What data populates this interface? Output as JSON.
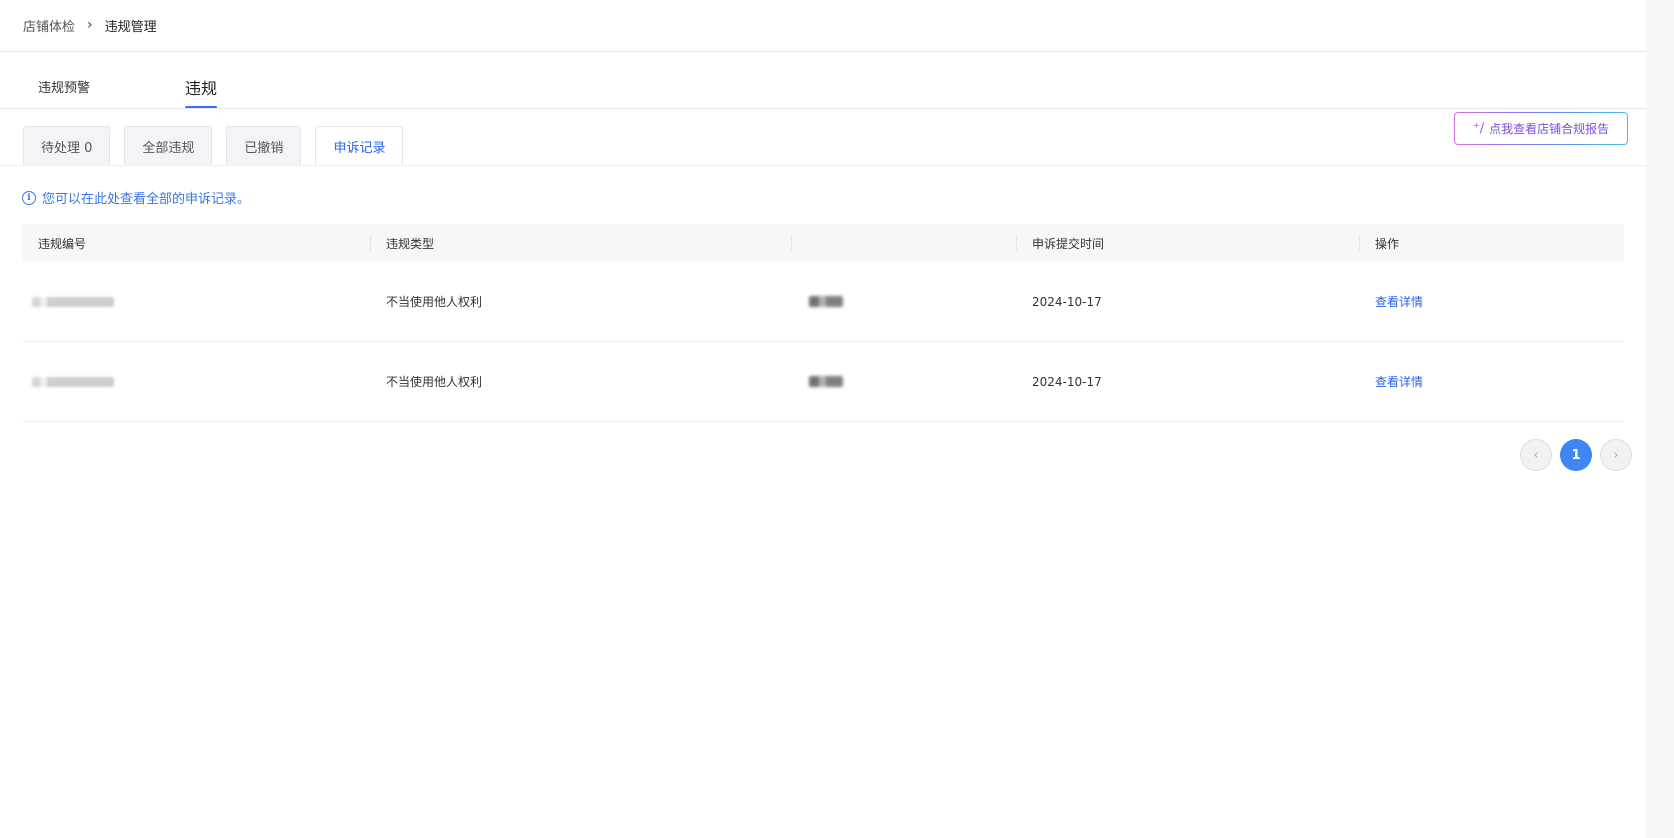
{
  "breadcrumb": {
    "parent": "店铺体检",
    "separator": "›",
    "current": "违规管理"
  },
  "main_tabs": [
    {
      "label": "违规预警",
      "active": false
    },
    {
      "label": "违规",
      "active": true
    }
  ],
  "sub_tabs": [
    {
      "label": "待处理 0",
      "active": false
    },
    {
      "label": "全部违规",
      "active": false
    },
    {
      "label": "已撤销",
      "active": false
    },
    {
      "label": "申诉记录",
      "active": true
    }
  ],
  "report_button": {
    "icon": "magic-wand-icon",
    "label": "点我查看店铺合规报告"
  },
  "notice": {
    "icon": "info-icon",
    "text": "您可以在此处查看全部的申诉记录。"
  },
  "table": {
    "headers": [
      "违规编号",
      "违规类型",
      "",
      "申诉提交时间",
      "操作"
    ],
    "rows": [
      {
        "violation_type": "不当使用他人权利",
        "submit_time": "2024-10-17",
        "action": "查看详情"
      },
      {
        "violation_type": "不当使用他人权利",
        "submit_time": "2024-10-17",
        "action": "查看详情"
      }
    ]
  },
  "pagination": {
    "prev": "‹",
    "current_page": "1",
    "next": "›"
  },
  "colors": {
    "accent": "#3370ff",
    "link": "#2b63e8",
    "page_active": "#3f86f5"
  }
}
